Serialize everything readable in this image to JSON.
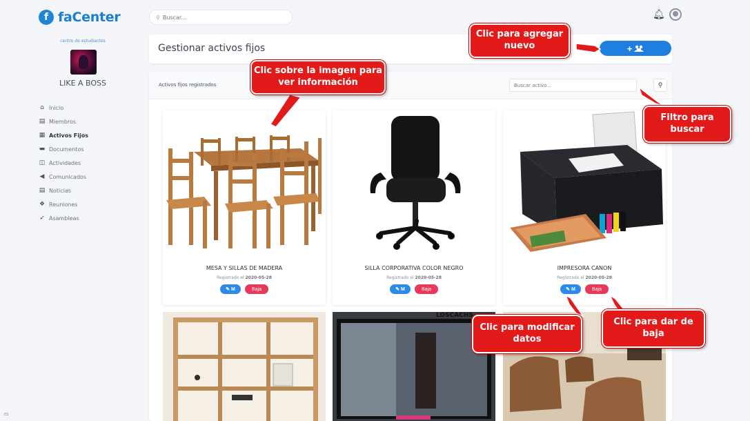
{
  "app": {
    "brand": "faCenter",
    "brand_mark": "f"
  },
  "sidebar": {
    "org_subtitle": "centro de estudiantes",
    "org_name": "LIKE A BOSS",
    "items": [
      {
        "icon": "home-icon",
        "glyph": "⌂",
        "label": "Inicio"
      },
      {
        "icon": "members-icon",
        "glyph": "▤",
        "label": "Miembros"
      },
      {
        "icon": "assets-icon",
        "glyph": "▦",
        "label": "Activos Fijos",
        "active": true
      },
      {
        "icon": "documents-icon",
        "glyph": "▬",
        "label": "Documentos"
      },
      {
        "icon": "activities-icon",
        "glyph": "◫",
        "label": "Actividades"
      },
      {
        "icon": "announcements-icon",
        "glyph": "◀",
        "label": "Comunicados"
      },
      {
        "icon": "news-icon",
        "glyph": "▤",
        "label": "Noticias"
      },
      {
        "icon": "meetings-icon",
        "glyph": "❖",
        "label": "Reuniones"
      },
      {
        "icon": "assemblies-icon",
        "glyph": "➶",
        "label": "Asambleas"
      }
    ]
  },
  "topbar": {
    "search_placeholder": "Buscar..."
  },
  "header": {
    "title": "Gestionar activos fijos",
    "add_label": "+"
  },
  "panel": {
    "title": "Activos fijos registrados",
    "filter_placeholder": "Buscar activo...",
    "search_glyph": "🔍"
  },
  "assets": [
    {
      "name": "MESA Y SILLAS DE MADERA",
      "registered_prefix": "Registrado el",
      "date": "2020-05-28",
      "edit_label": "M",
      "delete_label": "Baja"
    },
    {
      "name": "SILLA CORPORATIVA COLOR NEGRO",
      "registered_prefix": "Registrado el",
      "date": "2020-05-28",
      "edit_label": "M",
      "delete_label": "Baja"
    },
    {
      "name": "IMPRESORA CANON",
      "registered_prefix": "Registrado el",
      "date": "2020-05-28",
      "edit_label": "M",
      "delete_label": "Baja"
    }
  ],
  "bottom_photo_text": "LOSCACHS",
  "callouts": {
    "add": "Clic para agregar nuevo",
    "image": "Clic sobre la imagen para ver información",
    "filter": "Filtro para buscar",
    "edit": "Clic para modificar datos",
    "delete": "Clic para dar de baja"
  },
  "corner_text": "ES",
  "colors": {
    "brand": "#1b7fd0",
    "primary": "#1f7fe0",
    "danger": "#e8395a",
    "callout": "#e21a1a"
  }
}
